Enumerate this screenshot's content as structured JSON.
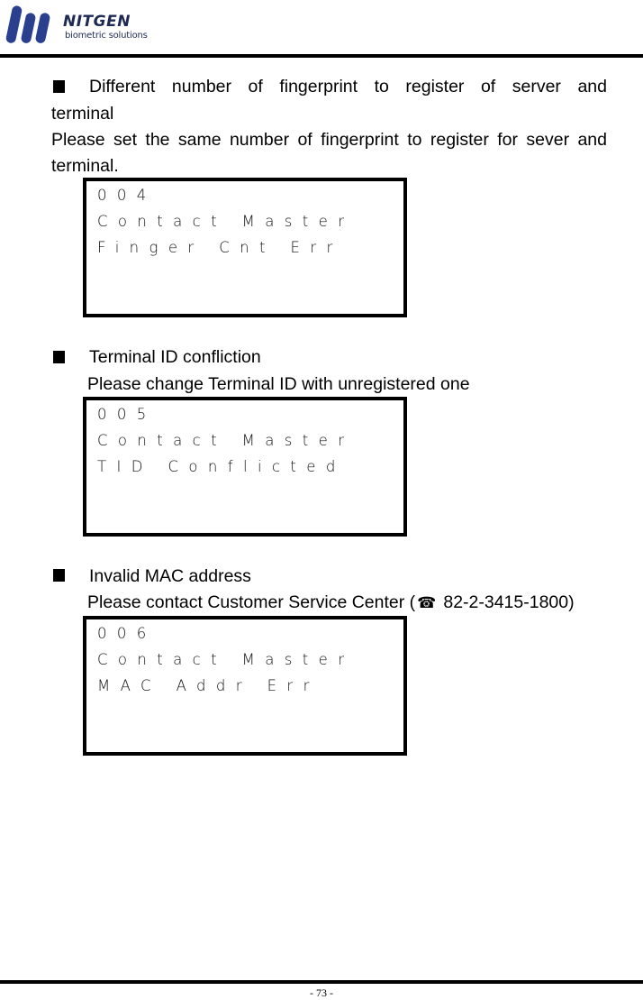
{
  "header": {
    "brand": "NITGEN",
    "tagline": "biometric solutions",
    "brand_color": "#1e2a55",
    "logo_icon": "nitgen-logo-icon"
  },
  "sections": [
    {
      "bullet": "■",
      "title_line1": "Different number of fingerprint to register of server and",
      "title_line2": "terminal",
      "desc_line1": "Please set the same number of fingerprint to register for sever and",
      "desc_line2": "terminal.",
      "lcd": {
        "lines": [
          "004",
          "Contact Master",
          "Finger Cnt Err"
        ]
      }
    },
    {
      "bullet": "■",
      "title": "Terminal ID confliction",
      "desc": "Please change Terminal ID with unregistered one",
      "lcd": {
        "lines": [
          "005",
          "Contact Master",
          "TID Conflicted"
        ]
      }
    },
    {
      "bullet": "■",
      "title": "Invalid MAC address",
      "desc_prefix": "Please contact Customer Service Center (",
      "phone_icon": "☎",
      "phone": "82-2-3415-1800)",
      "lcd": {
        "lines": [
          "006",
          "Contact Master",
          "MAC Addr Err"
        ]
      }
    }
  ],
  "footer": {
    "page_number": "- 73 -"
  }
}
